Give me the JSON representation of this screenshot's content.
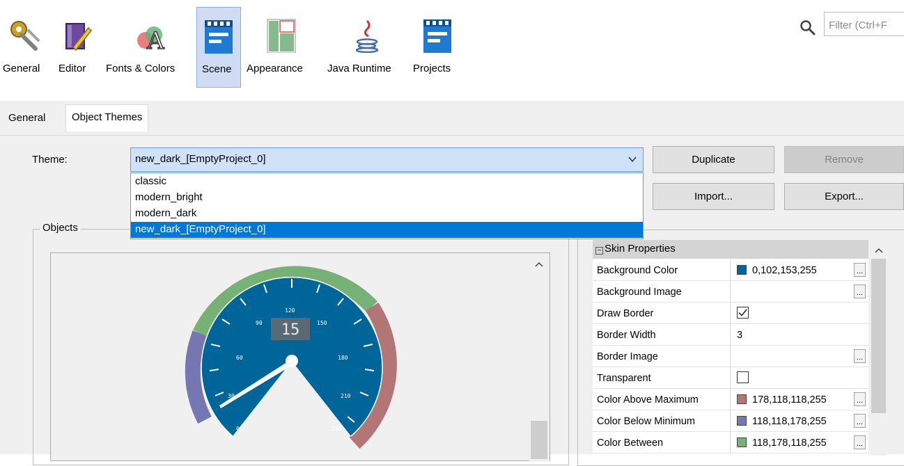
{
  "toolbar": {
    "items": [
      {
        "label": "General",
        "icon": "general-settings-icon"
      },
      {
        "label": "Editor",
        "icon": "editor-icon"
      },
      {
        "label": "Fonts & Colors",
        "icon": "fonts-colors-icon"
      },
      {
        "label": "Scene",
        "icon": "scene-icon",
        "selected": true
      },
      {
        "label": "Appearance",
        "icon": "appearance-icon"
      },
      {
        "label": "Java Runtime",
        "icon": "java-runtime-icon"
      },
      {
        "label": "Projects",
        "icon": "projects-icon"
      }
    ],
    "filter_placeholder": "Filter (Ctrl+F"
  },
  "tabs": [
    {
      "label": "General"
    },
    {
      "label": "Object Themes",
      "active": true
    }
  ],
  "theme": {
    "label": "Theme:",
    "selected": "new_dark_[EmptyProject_0]",
    "options": [
      "classic",
      "modern_bright",
      "modern_dark",
      "new_dark_[EmptyProject_0]"
    ]
  },
  "buttons": {
    "duplicate": "Duplicate",
    "remove": "Remove",
    "import": "Import...",
    "export": "Export..."
  },
  "objects": {
    "title": "Objects",
    "gauge": {
      "digital_readout": "15",
      "scale_labels": [
        "0",
        "30",
        "60",
        "90",
        "120",
        "150",
        "180",
        "210",
        "240"
      ]
    }
  },
  "properties": {
    "section": "Skin Properties",
    "rows": [
      {
        "name": "Background Color",
        "value": "0,102,153,255",
        "swatch": "#006699",
        "ellipsis": true
      },
      {
        "name": "Background Image",
        "value": "",
        "ellipsis": true
      },
      {
        "name": "Draw Border",
        "checkbox": true,
        "checked": true
      },
      {
        "name": "Border Width",
        "value": "3"
      },
      {
        "name": "Border Image",
        "value": "",
        "ellipsis": true
      },
      {
        "name": "Transparent",
        "checkbox": true,
        "checked": false
      },
      {
        "name": "Color Above Maximum",
        "value": "178,118,118,255",
        "swatch": "#b27676",
        "ellipsis": true
      },
      {
        "name": "Color Below Minimum",
        "value": "118,118,178,255",
        "swatch": "#7676b2",
        "ellipsis": true
      },
      {
        "name": "Color Between",
        "value": "118,178,118,255",
        "swatch": "#76b276",
        "ellipsis": true
      }
    ]
  },
  "colors": {
    "selection": "#0078d7",
    "gauge_face": "#006699"
  }
}
